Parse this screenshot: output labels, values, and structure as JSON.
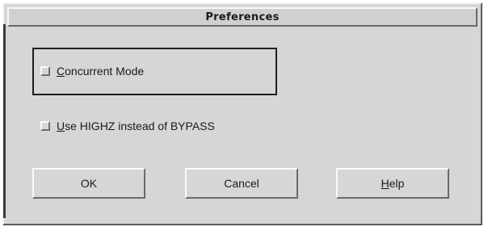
{
  "window": {
    "title": "Preferences"
  },
  "options": {
    "concurrent_mode": {
      "mnemonic": "C",
      "rest": "oncurrent Mode",
      "checked": false
    },
    "use_highz": {
      "mnemonic": "U",
      "rest": "se HIGHZ instead of BYPASS",
      "checked": false
    }
  },
  "buttons": {
    "ok_label": "OK",
    "cancel_label": "Cancel",
    "help_mnemonic": "H",
    "help_rest": "elp"
  }
}
